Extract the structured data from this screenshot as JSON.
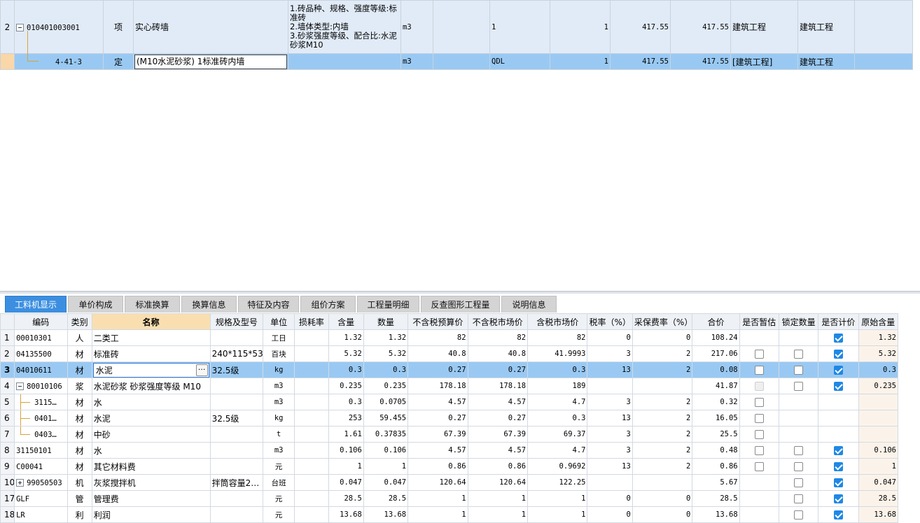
{
  "top_grid": {
    "rows": [
      {
        "num": "2",
        "code": "010401003001",
        "type": "项",
        "name": "实心砖墙",
        "features": "1.砖品种、规格、强度等级:标准砖\n2.墙体类型:内墙\n3.砂浆强度等级、配合比:水泥砂浆M10",
        "unit": "m3",
        "expr": "",
        "qty_expr": "1",
        "content": "1",
        "qty": "417.55",
        "qty2": "417.55",
        "specialty": "建筑工程",
        "specialty2": "建筑工程"
      },
      {
        "num": "",
        "code": "4-41-3",
        "type": "定",
        "name": "(M10水泥砂浆) 1标准砖内墙",
        "features": "",
        "unit": "m3",
        "expr": "",
        "qty_expr": "QDL",
        "content": "1",
        "qty": "417.55",
        "qty2": "417.55",
        "specialty": "[建筑工程]",
        "specialty2": "建筑工程"
      }
    ]
  },
  "tabs": [
    {
      "label": "工料机显示",
      "active": true
    },
    {
      "label": "单价构成"
    },
    {
      "label": "标准换算"
    },
    {
      "label": "换算信息"
    },
    {
      "label": "特征及内容"
    },
    {
      "label": "组价方案"
    },
    {
      "label": "工程量明细"
    },
    {
      "label": "反查图形工程量"
    },
    {
      "label": "说明信息"
    }
  ],
  "bottom_grid": {
    "headers": [
      "编码",
      "类别",
      "名称",
      "规格及型号",
      "单位",
      "损耗率",
      "含量",
      "数量",
      "不含税预算价",
      "不含税市场价",
      "含税市场价",
      "税率（%）",
      "采保费率（%）",
      "合价",
      "是否暂估",
      "锁定数量",
      "是否计价",
      "原始含量"
    ],
    "rows": [
      {
        "rn": "1",
        "code": "00010301",
        "cat": "人",
        "name": "二类工",
        "spec": "",
        "unit": "工日",
        "loss": "",
        "content": "1.32",
        "qty": "1.32",
        "p1": "82",
        "p2": "82",
        "p3": "82",
        "tax": "0",
        "fee": "0",
        "total": "108.24",
        "est": "none",
        "lock": "none",
        "priced": "checked",
        "orig": "1.32"
      },
      {
        "rn": "2",
        "code": "04135500",
        "cat": "材",
        "name": "标准砖",
        "spec": "240*115*53",
        "unit": "百块",
        "loss": "",
        "content": "5.32",
        "qty": "5.32",
        "p1": "40.8",
        "p2": "40.8",
        "p3": "41.9993",
        "tax": "3",
        "fee": "2",
        "total": "217.06",
        "est": "empty",
        "lock": "empty",
        "priced": "checked",
        "orig": "5.32"
      },
      {
        "rn": "3",
        "code": "04010611",
        "cat": "材",
        "name": "水泥",
        "spec": "32.5级",
        "unit": "kg",
        "loss": "",
        "content": "0.3",
        "qty": "0.3",
        "p1": "0.27",
        "p2": "0.27",
        "p3": "0.3",
        "tax": "13",
        "fee": "2",
        "total": "0.08",
        "est": "empty",
        "lock": "empty",
        "priced": "checked",
        "orig": "0.3",
        "selected": true
      },
      {
        "rn": "4",
        "code": "80010106",
        "cat": "浆",
        "name": "水泥砂浆 砂浆强度等级 M10",
        "spec": "",
        "unit": "m3",
        "loss": "",
        "content": "0.235",
        "qty": "0.235",
        "p1": "178.18",
        "p2": "178.18",
        "p3": "189",
        "tax": "",
        "fee": "",
        "total": "41.87",
        "est": "disabled",
        "lock": "empty",
        "priced": "checked",
        "orig": "0.235",
        "tree": "minus"
      },
      {
        "rn": "5",
        "code": "3115…",
        "cat": "材",
        "name": "水",
        "spec": "",
        "unit": "m3",
        "loss": "",
        "content": "0.3",
        "qty": "0.0705",
        "p1": "4.57",
        "p2": "4.57",
        "p3": "4.7",
        "tax": "3",
        "fee": "2",
        "total": "0.32",
        "est": "empty",
        "lock": "none",
        "priced": "none",
        "orig": "",
        "child": true
      },
      {
        "rn": "6",
        "code": "0401…",
        "cat": "材",
        "name": "水泥",
        "spec": "32.5级",
        "unit": "kg",
        "loss": "",
        "content": "253",
        "qty": "59.455",
        "p1": "0.27",
        "p2": "0.27",
        "p3": "0.3",
        "tax": "13",
        "fee": "2",
        "total": "16.05",
        "est": "empty",
        "lock": "none",
        "priced": "none",
        "orig": "",
        "child": true
      },
      {
        "rn": "7",
        "code": "0403…",
        "cat": "材",
        "name": "中砂",
        "spec": "",
        "unit": "t",
        "loss": "",
        "content": "1.61",
        "qty": "0.37835",
        "p1": "67.39",
        "p2": "67.39",
        "p3": "69.37",
        "tax": "3",
        "fee": "2",
        "total": "25.5",
        "est": "empty",
        "lock": "none",
        "priced": "none",
        "orig": "",
        "child": true,
        "last_child": true
      },
      {
        "rn": "8",
        "code": "31150101",
        "cat": "材",
        "name": "水",
        "spec": "",
        "unit": "m3",
        "loss": "",
        "content": "0.106",
        "qty": "0.106",
        "p1": "4.57",
        "p2": "4.57",
        "p3": "4.7",
        "tax": "3",
        "fee": "2",
        "total": "0.48",
        "est": "empty",
        "lock": "empty",
        "priced": "checked",
        "orig": "0.106"
      },
      {
        "rn": "9",
        "code": "C00041",
        "cat": "材",
        "name": "其它材料费",
        "spec": "",
        "unit": "元",
        "loss": "",
        "content": "1",
        "qty": "1",
        "p1": "0.86",
        "p2": "0.86",
        "p3": "0.9692",
        "tax": "13",
        "fee": "2",
        "total": "0.86",
        "est": "empty",
        "lock": "empty",
        "priced": "checked",
        "orig": "1"
      },
      {
        "rn": "10",
        "code": "99050503",
        "cat": "机",
        "name": "灰浆搅拌机",
        "spec": "拌筒容量2…",
        "unit": "台班",
        "loss": "",
        "content": "0.047",
        "qty": "0.047",
        "p1": "120.64",
        "p2": "120.64",
        "p3": "122.25",
        "tax": "",
        "fee": "",
        "total": "5.67",
        "est": "none",
        "lock": "empty",
        "priced": "checked",
        "orig": "0.047",
        "tree": "plus"
      },
      {
        "rn": "17",
        "code": "GLF",
        "cat": "管",
        "name": "管理费",
        "spec": "",
        "unit": "元",
        "loss": "",
        "content": "28.5",
        "qty": "28.5",
        "p1": "1",
        "p2": "1",
        "p3": "1",
        "tax": "0",
        "fee": "0",
        "total": "28.5",
        "est": "none",
        "lock": "empty",
        "priced": "checked",
        "orig": "28.5"
      },
      {
        "rn": "18",
        "code": "LR",
        "cat": "利",
        "name": "利润",
        "spec": "",
        "unit": "元",
        "loss": "",
        "content": "13.68",
        "qty": "13.68",
        "p1": "1",
        "p2": "1",
        "p3": "1",
        "tax": "0",
        "fee": "0",
        "total": "13.68",
        "est": "none",
        "lock": "empty",
        "priced": "checked",
        "orig": "13.68"
      }
    ]
  },
  "colors": {
    "accent": "#3c8fe0",
    "selected_row": "#99c9f3",
    "top_row_bg": "#e1ebf7",
    "header_highlight": "#f9dfb0",
    "checkbox_checked": "#1e88e5"
  }
}
